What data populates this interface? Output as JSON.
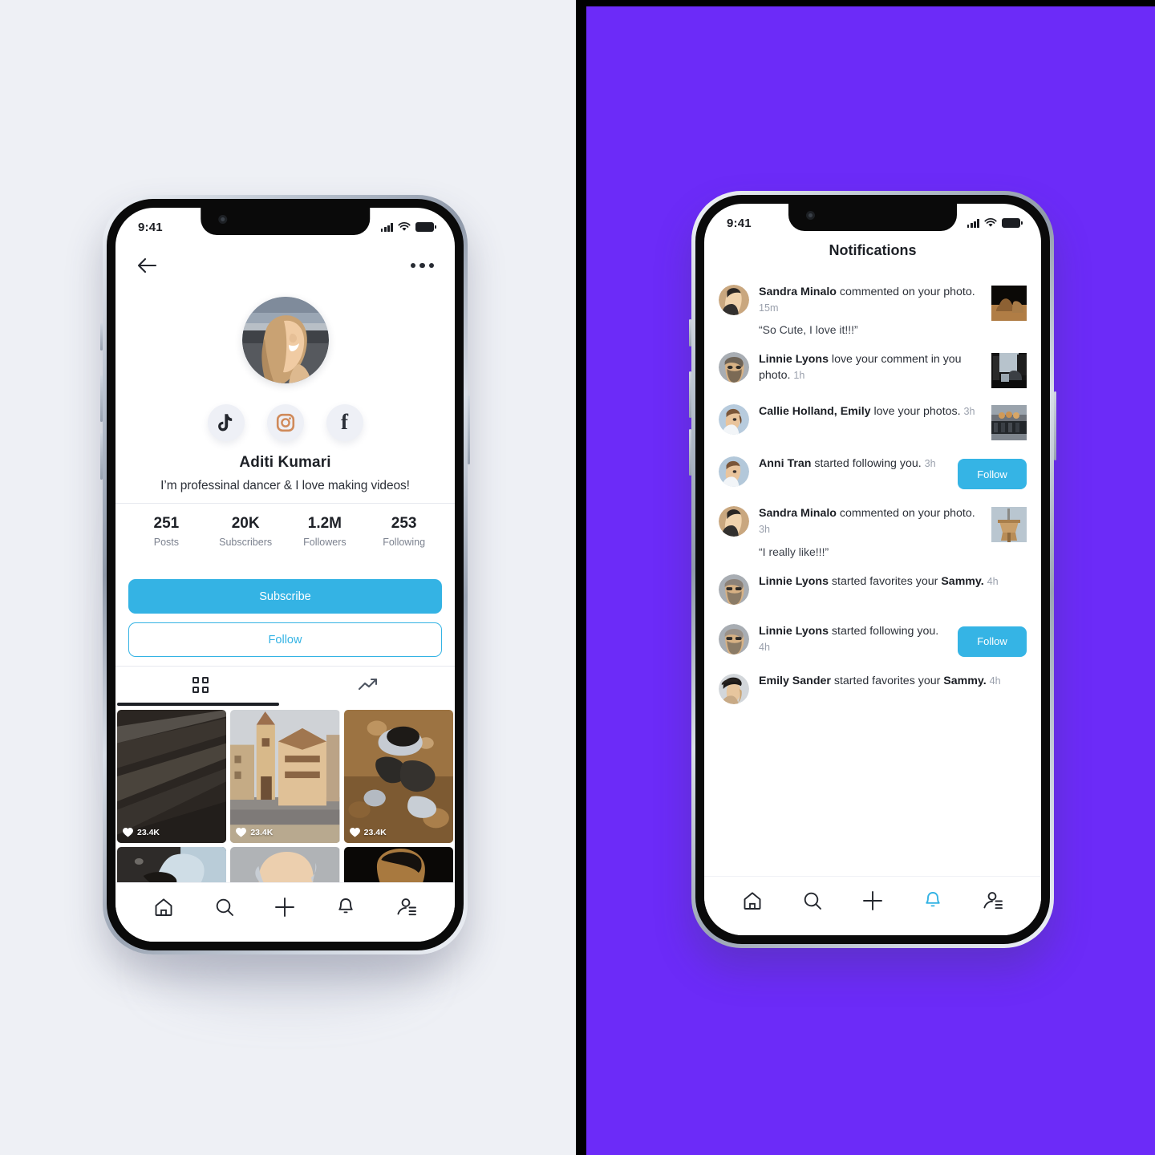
{
  "canvas": {
    "left_bg": "#eef0f5",
    "right_bg": "#6C2BF8",
    "divider": "#000000"
  },
  "accent": "#34b3e4",
  "phone_profile": {
    "status": {
      "time": "9:41",
      "signal_icon": "signal-bars-icon",
      "wifi_icon": "wifi-icon",
      "battery_icon": "battery-icon"
    },
    "topnav": {
      "back_icon": "back-arrow-icon",
      "more_icon": "more-options-icon"
    },
    "avatar_name": "profile-avatar",
    "socials": [
      {
        "name": "tiktok",
        "icon": "tiktok-icon"
      },
      {
        "name": "instagram",
        "icon": "instagram-icon"
      },
      {
        "name": "facebook",
        "icon": "facebook-icon",
        "glyph": "f"
      }
    ],
    "name": "Aditi Kumari",
    "bio": "I’m professinal dancer & I love making videos!",
    "stats": [
      {
        "value": "251",
        "label": "Posts"
      },
      {
        "value": "20K",
        "label": "Subscribers"
      },
      {
        "value": "1.2M",
        "label": "Followers"
      },
      {
        "value": "253",
        "label": "Following"
      }
    ],
    "subscribe_label": "Subscribe",
    "follow_label": "Follow",
    "tabs": [
      {
        "name": "grid",
        "icon": "grid-icon",
        "active": true
      },
      {
        "name": "trending",
        "icon": "trending-up-icon",
        "active": false
      }
    ],
    "photos": [
      {
        "id": "p1",
        "likes": "23.4K",
        "kind": "dark-fabric"
      },
      {
        "id": "p2",
        "likes": "23.4K",
        "kind": "town-street"
      },
      {
        "id": "p3",
        "likes": "23.4K",
        "kind": "runner"
      },
      {
        "id": "p4",
        "likes": "",
        "kind": "hat-man"
      },
      {
        "id": "p5",
        "likes": "",
        "kind": "glasses-man"
      },
      {
        "id": "p6",
        "likes": "",
        "kind": "dark-portrait"
      }
    ],
    "tabbar": [
      {
        "name": "home",
        "icon": "home-icon",
        "active": false
      },
      {
        "name": "search",
        "icon": "search-icon",
        "active": false
      },
      {
        "name": "add",
        "icon": "plus-icon",
        "active": false
      },
      {
        "name": "notifications",
        "icon": "bell-icon",
        "active": false
      },
      {
        "name": "profile",
        "icon": "profile-list-icon",
        "active": false
      }
    ]
  },
  "phone_notifications": {
    "status": {
      "time": "9:41",
      "signal_icon": "signal-bars-icon",
      "wifi_icon": "wifi-icon",
      "battery_icon": "battery-icon"
    },
    "title": "Notifications",
    "items": [
      {
        "user": "Sandra Minalo",
        "action": "commented on your photo.",
        "time": "15m",
        "quote": "“So Cute, I love it!!!”",
        "trailing": "thumb",
        "thumb_kind": "camel-dark"
      },
      {
        "user": "Linnie Lyons",
        "action": "love your comment in you photo.",
        "time": "1h",
        "quote": "",
        "trailing": "thumb",
        "thumb_kind": "street-night"
      },
      {
        "user": "Callie Holland, Emily",
        "action": "love your photos.",
        "time": "3h",
        "quote": "",
        "trailing": "thumb",
        "thumb_kind": "market-stall"
      },
      {
        "user": "Anni Tran",
        "action": "started following you.",
        "time": "3h",
        "quote": "",
        "trailing": "follow",
        "follow_label": "Follow"
      },
      {
        "user": "Sandra Minalo",
        "action": "commented on your photo.",
        "time": "3h",
        "quote": "“I really like!!!”",
        "trailing": "thumb",
        "thumb_kind": "easel"
      },
      {
        "user": "Linnie Lyons",
        "action": "started favorites your <b>Sammy.</b>",
        "time": "4h",
        "quote": "",
        "trailing": "none"
      },
      {
        "user": "Linnie Lyons",
        "action": "started following you.",
        "time": "4h",
        "quote": "",
        "trailing": "follow",
        "follow_label": "Follow"
      },
      {
        "user": "Emily Sander",
        "action": "started favorites your <b>Sammy.</b>",
        "time": "4h",
        "quote": "",
        "trailing": "none"
      }
    ],
    "tabbar": [
      {
        "name": "home",
        "icon": "home-icon",
        "active": false
      },
      {
        "name": "search",
        "icon": "search-icon",
        "active": false
      },
      {
        "name": "add",
        "icon": "plus-icon",
        "active": false
      },
      {
        "name": "notifications",
        "icon": "bell-icon",
        "active": true
      },
      {
        "name": "profile",
        "icon": "profile-list-icon",
        "active": false
      }
    ]
  }
}
